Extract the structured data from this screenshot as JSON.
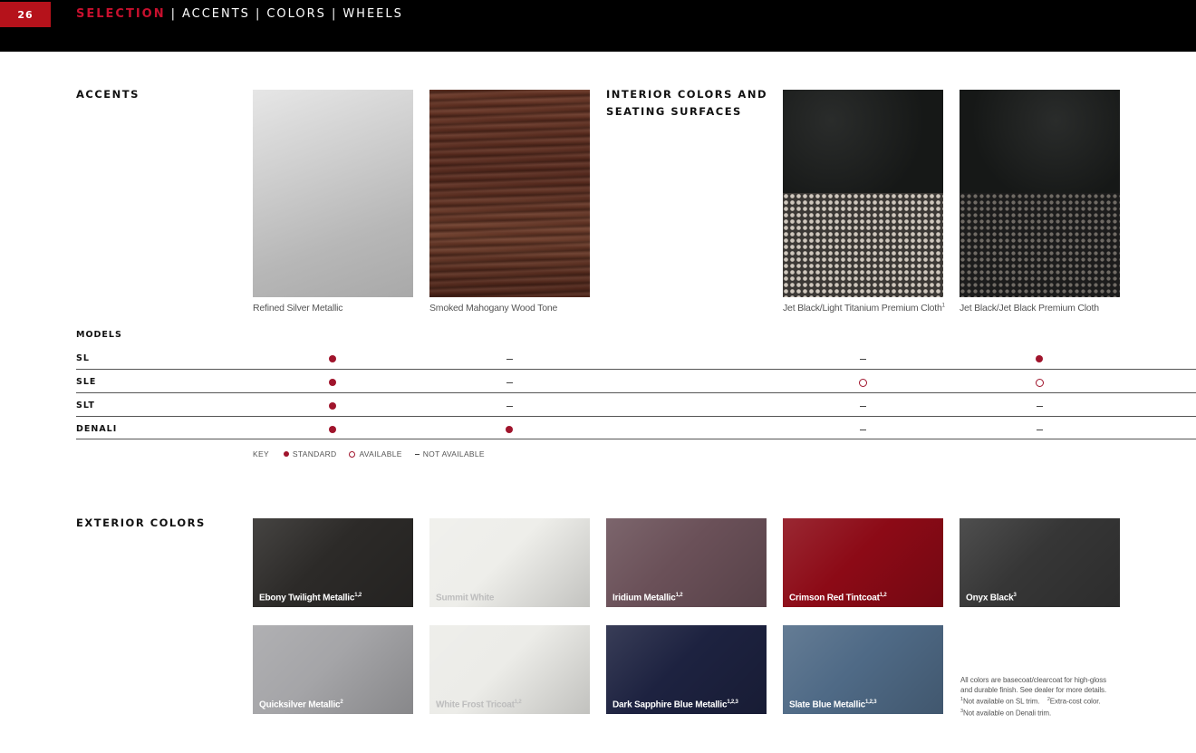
{
  "header": {
    "page_number": "26",
    "nav": [
      {
        "label": "SELECTION",
        "active": true
      },
      {
        "label": "ACCENTS",
        "active": false
      },
      {
        "label": "COLORS",
        "active": false
      },
      {
        "label": "WHEELS",
        "active": false
      }
    ],
    "separator": "|"
  },
  "accents": {
    "title": "ACCENTS",
    "items": [
      {
        "label": "Refined Silver Metallic"
      },
      {
        "label": "Smoked Mahogany Wood Tone"
      }
    ]
  },
  "interior": {
    "title_line1": "INTERIOR COLORS AND",
    "title_line2": "SEATING SURFACES",
    "items": [
      {
        "label": "Jet Black/Light Titanium Premium Cloth",
        "sup": "1"
      },
      {
        "label": "Jet Black/Jet Black Premium Cloth",
        "sup": ""
      }
    ]
  },
  "models": {
    "heading": "MODELS",
    "rows": [
      {
        "name": "SL",
        "marks": [
          "standard",
          "not_available",
          "not_available",
          "standard"
        ]
      },
      {
        "name": "SLE",
        "marks": [
          "standard",
          "not_available",
          "available",
          "available"
        ]
      },
      {
        "name": "SLT",
        "marks": [
          "standard",
          "not_available",
          "not_available",
          "not_available"
        ]
      },
      {
        "name": "DENALI",
        "marks": [
          "standard",
          "standard",
          "not_available",
          "not_available"
        ]
      }
    ]
  },
  "key": {
    "label": "KEY",
    "standard": "STANDARD",
    "available": "AVAILABLE",
    "not_available": "NOT AVAILABLE"
  },
  "exterior": {
    "title": "EXTERIOR COLORS",
    "items": [
      {
        "name": "Ebony Twilight Metallic",
        "sup": "1,2",
        "color": "#2c2a28"
      },
      {
        "name": "Summit White",
        "sup": "",
        "color": "#eeeeea"
      },
      {
        "name": "Iridium Metallic",
        "sup": "1,2",
        "color": "#6a5058"
      },
      {
        "name": "Crimson Red Tintcoat",
        "sup": "1,2",
        "color": "#8c0a16"
      },
      {
        "name": "Onyx Black",
        "sup": "3",
        "color": "#363636"
      },
      {
        "name": "Quicksilver Metallic",
        "sup": "2",
        "color": "#a5a5a8"
      },
      {
        "name": "White Frost Tricoat",
        "sup": "1,2",
        "color": "#ecece8"
      },
      {
        "name": "Dark Sapphire Blue Metallic",
        "sup": "1,2,3",
        "color": "#1d2240"
      },
      {
        "name": "Slate Blue Metallic",
        "sup": "1,2,3",
        "color": "#4f6a86"
      }
    ]
  },
  "footnote": {
    "line1": "All colors are basecoat/clearcoat for high-gloss",
    "line2": "and durable finish. See dealer for more details.",
    "note1_sup": "1",
    "note1": "Not available on SL trim.",
    "note2_sup": "2",
    "note2": "Extra-cost color.",
    "note3_sup": "3",
    "note3": "Not available on Denali trim."
  },
  "colors": {
    "accent_red": "#b5121b",
    "dot_red": "#a0142c"
  }
}
